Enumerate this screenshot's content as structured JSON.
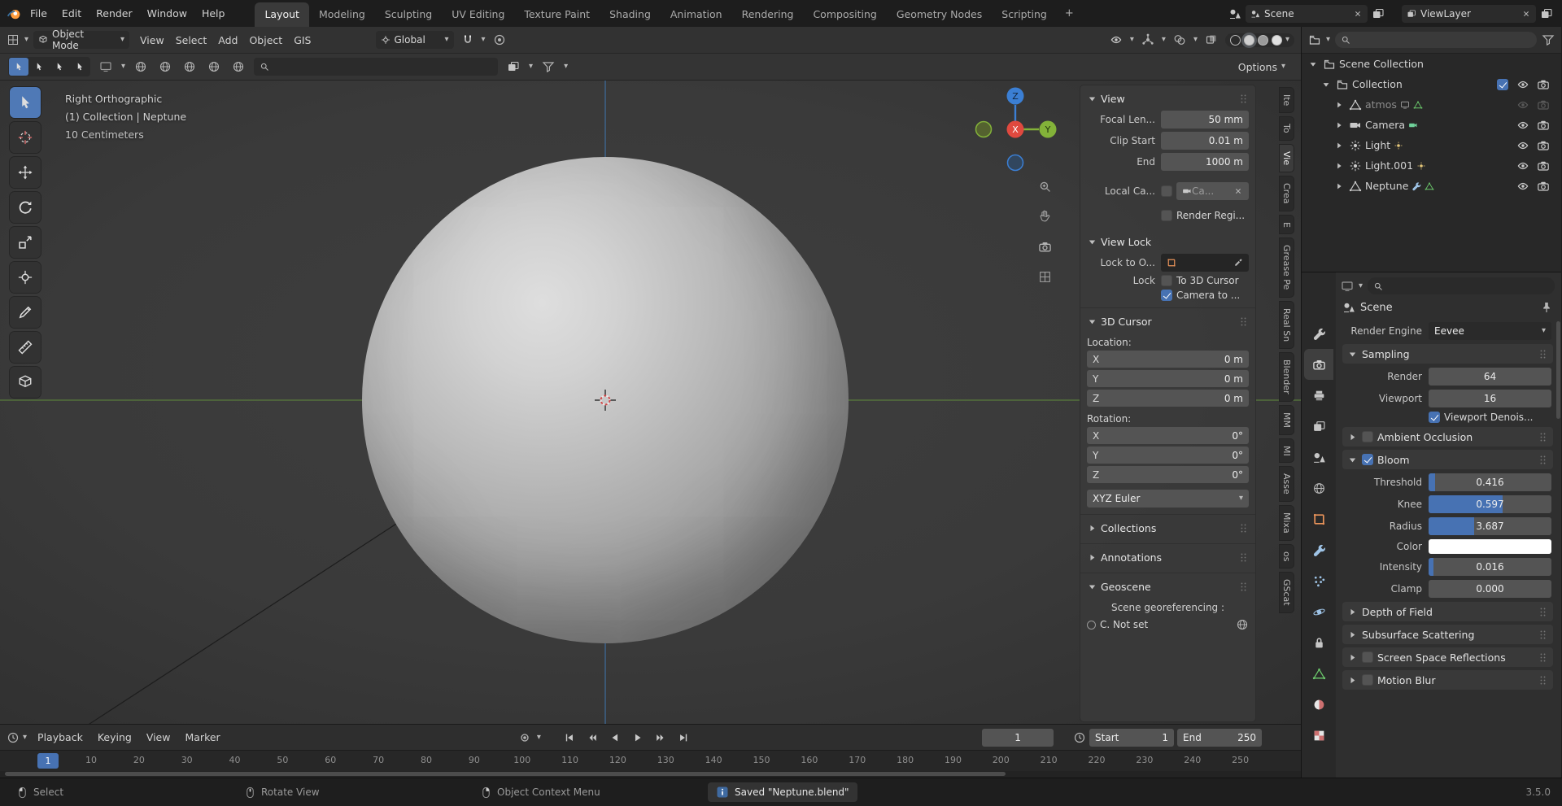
{
  "app": {
    "version": "3.5.0"
  },
  "topbar": {
    "menus": [
      "File",
      "Edit",
      "Render",
      "Window",
      "Help"
    ],
    "workspaces": [
      "Layout",
      "Modeling",
      "Sculpting",
      "UV Editing",
      "Texture Paint",
      "Shading",
      "Animation",
      "Rendering",
      "Compositing",
      "Geometry Nodes",
      "Scripting"
    ],
    "active_workspace": "Layout",
    "add_workspace": "+",
    "scene": "Scene",
    "viewlayer": "ViewLayer"
  },
  "viewport_header": {
    "mode": "Object Mode",
    "menus": [
      "View",
      "Select",
      "Add",
      "Object",
      "GIS"
    ],
    "orientation": "Global"
  },
  "tool_settings": {
    "options_label": "Options"
  },
  "viewport": {
    "overlay": {
      "line1": "Right Orthographic",
      "line2": "(1) Collection | Neptune",
      "line3": "10 Centimeters"
    },
    "gizmo": {
      "x": "X",
      "y": "Y",
      "z": "Z"
    }
  },
  "left_toolbar": [
    {
      "name": "select-box",
      "icon": "select",
      "active": true
    },
    {
      "name": "cursor",
      "icon": "cursor-tool"
    },
    {
      "name": "move",
      "icon": "move"
    },
    {
      "name": "rotate",
      "icon": "rotate"
    },
    {
      "name": "scale",
      "icon": "scale"
    },
    {
      "name": "transform",
      "icon": "transform"
    },
    {
      "name": "annotate",
      "icon": "annotate"
    },
    {
      "name": "measure",
      "icon": "measure"
    },
    {
      "name": "add-cube",
      "icon": "addcube"
    }
  ],
  "side_tabs": {
    "items": [
      "Ite",
      "To",
      "Vie",
      "Crea",
      "E",
      "Grease Pe",
      "Real Sn",
      "Blender",
      "MM",
      "MI",
      "Asse",
      "Mixa",
      "os",
      "GScat"
    ],
    "active_index": 2
  },
  "npanel": {
    "view": {
      "title": "View",
      "focal_label": "Focal Len...",
      "focal_value": "50 mm",
      "clip_start_label": "Clip Start",
      "clip_start_value": "0.01 m",
      "clip_end_label": "End",
      "clip_end_value": "1000 m",
      "local_cam_label": "Local Ca...",
      "local_cam_value": "Ca...",
      "render_region_label": "Render Regi..."
    },
    "view_lock": {
      "title": "View Lock",
      "lock_obj_label": "Lock to O...",
      "lock_label": "Lock",
      "to_3d_cursor": "To 3D Cursor",
      "camera_to_view": "Camera to ..."
    },
    "cursor3d": {
      "title": "3D Cursor",
      "location_label": "Location:",
      "loc": [
        {
          "axis": "X",
          "value": "0 m"
        },
        {
          "axis": "Y",
          "value": "0 m"
        },
        {
          "axis": "Z",
          "value": "0 m"
        }
      ],
      "rotation_label": "Rotation:",
      "rot": [
        {
          "axis": "X",
          "value": "0°"
        },
        {
          "axis": "Y",
          "value": "0°"
        },
        {
          "axis": "Z",
          "value": "0°"
        }
      ],
      "rotation_mode": "XYZ Euler"
    },
    "collections_title": "Collections",
    "annotations_title": "Annotations",
    "geoscene": {
      "title": "Geoscene",
      "subtitle": "Scene georeferencing :",
      "status": "C.   Not set"
    }
  },
  "outliner": {
    "rows": [
      {
        "label": "Scene Collection",
        "icon": "collection",
        "indent": 0,
        "expanded": true,
        "checkbox": null,
        "eye": null,
        "cam": null,
        "extras": []
      },
      {
        "label": "Collection",
        "icon": "collection",
        "indent": 1,
        "expanded": true,
        "checkbox": true,
        "eye": true,
        "cam": true,
        "extras": []
      },
      {
        "label": "atmos",
        "icon": "mesh",
        "indent": 2,
        "dim": true,
        "eye": false,
        "cam": false,
        "extras": [
          "screen",
          "mesh-data"
        ]
      },
      {
        "label": "Camera",
        "icon": "camera-obj",
        "indent": 2,
        "eye": true,
        "cam": true,
        "extras": [
          "camera-data"
        ]
      },
      {
        "label": "Light",
        "icon": "light",
        "indent": 2,
        "eye": true,
        "cam": true,
        "extras": [
          "light-data"
        ]
      },
      {
        "label": "Light.001",
        "icon": "light",
        "indent": 2,
        "eye": true,
        "cam": true,
        "extras": [
          "light-data"
        ]
      },
      {
        "label": "Neptune",
        "icon": "mesh",
        "indent": 2,
        "eye": true,
        "cam": true,
        "extras": [
          "wrench",
          "mesh-data"
        ]
      }
    ]
  },
  "properties": {
    "tabs": [
      {
        "name": "tool",
        "icon": "tool"
      },
      {
        "name": "render",
        "icon": "render",
        "active": true
      },
      {
        "name": "output",
        "icon": "printer"
      },
      {
        "name": "view-layer",
        "icon": "images"
      },
      {
        "name": "scene",
        "icon": "scene-data"
      },
      {
        "name": "world",
        "icon": "world"
      },
      {
        "name": "object",
        "icon": "object"
      },
      {
        "name": "modifiers",
        "icon": "wrench"
      },
      {
        "name": "particles",
        "icon": "particles"
      },
      {
        "name": "physics",
        "icon": "physics"
      },
      {
        "name": "constraints",
        "icon": "constraints"
      },
      {
        "name": "object-data",
        "icon": "mesh-data"
      },
      {
        "name": "material",
        "icon": "material"
      },
      {
        "name": "texture",
        "icon": "texture"
      }
    ],
    "breadcrumb": "Scene",
    "render_engine_label": "Render Engine",
    "render_engine": "Eevee",
    "sampling": {
      "title": "Sampling",
      "render_label": "Render",
      "render": "64",
      "viewport_label": "Viewport",
      "viewport": "16",
      "denoise_label": "Viewport Denois..."
    },
    "ambient_occlusion": "Ambient Occlusion",
    "bloom": {
      "title": "Bloom",
      "rows": [
        {
          "label": "Threshold",
          "value": "0.416",
          "fill": 0.05,
          "type": "slider"
        },
        {
          "label": "Knee",
          "value": "0.597",
          "fill": 0.6,
          "type": "slider"
        },
        {
          "label": "Radius",
          "value": "3.687",
          "fill": 0.37,
          "type": "slider"
        },
        {
          "label": "Color",
          "value": "#ffffff",
          "type": "color"
        },
        {
          "label": "Intensity",
          "value": "0.016",
          "fill": 0.04,
          "type": "slider"
        },
        {
          "label": "Clamp",
          "value": "0.000",
          "fill": 0,
          "type": "slider"
        }
      ]
    },
    "collapsed_panels": [
      {
        "title": "Depth of Field",
        "checkbox": null
      },
      {
        "title": "Subsurface Scattering",
        "checkbox": null
      },
      {
        "title": "Screen Space Reflections",
        "checkbox": false
      },
      {
        "title": "Motion Blur",
        "checkbox": false
      }
    ]
  },
  "timeline": {
    "menus": [
      "Playback",
      "Keying",
      "View",
      "Marker"
    ],
    "current_frame": "1",
    "start_label": "Start",
    "start": "1",
    "end_label": "End",
    "end": "250",
    "ruler": [
      1,
      10,
      20,
      30,
      40,
      50,
      60,
      70,
      80,
      90,
      100,
      110,
      120,
      130,
      140,
      150,
      160,
      170,
      180,
      190,
      200,
      210,
      220,
      230,
      240,
      250
    ]
  },
  "statusbar": {
    "hints": [
      {
        "icon": "mouse-l",
        "label": "Select"
      },
      {
        "icon": "mouse-m",
        "label": "Rotate View"
      },
      {
        "icon": "mouse-r",
        "label": "Object Context Menu"
      }
    ],
    "message": "Saved \"Neptune.blend\"",
    "version": "3.5.0"
  }
}
